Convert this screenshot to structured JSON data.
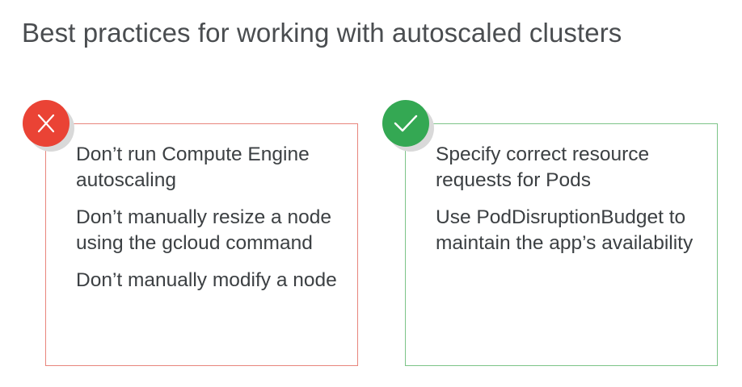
{
  "slide": {
    "title": "Best practices for working with autoscaled clusters"
  },
  "dont_panel": {
    "icon": "x-icon",
    "accent_color": "#ea4335",
    "items": [
      "Don’t run Compute Engine autoscaling",
      "Don’t manually resize a node using the gcloud command",
      "Don’t manually modify a node"
    ]
  },
  "do_panel": {
    "icon": "checkmark-icon",
    "accent_color": "#34a853",
    "items": [
      "Specify correct resource requests for Pods",
      "Use PodDisruptionBudget to maintain the app’s availability"
    ]
  }
}
